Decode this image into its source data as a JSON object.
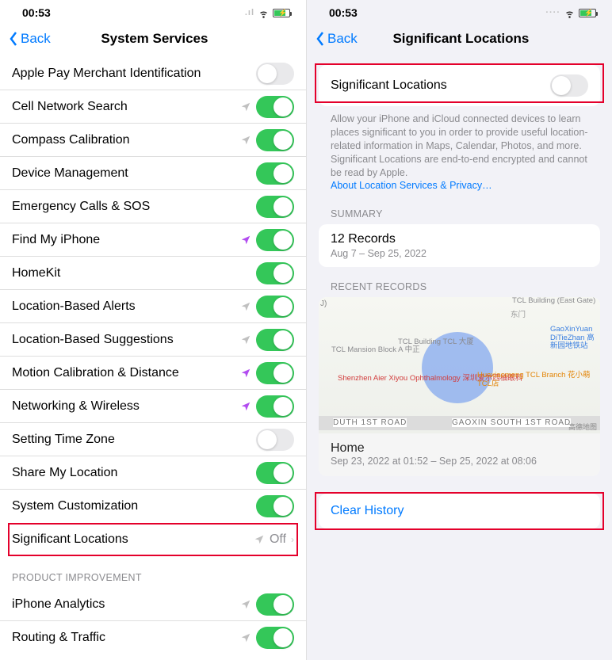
{
  "left": {
    "time": "00:53",
    "back": "Back",
    "title": "System Services",
    "items": [
      {
        "label": "Apple Pay Merchant Identification",
        "toggle": false,
        "loc": null
      },
      {
        "label": "Cell Network Search",
        "toggle": true,
        "loc": "gray"
      },
      {
        "label": "Compass Calibration",
        "toggle": true,
        "loc": "gray"
      },
      {
        "label": "Device Management",
        "toggle": true,
        "loc": null
      },
      {
        "label": "Emergency Calls & SOS",
        "toggle": true,
        "loc": null
      },
      {
        "label": "Find My iPhone",
        "toggle": true,
        "loc": "purple"
      },
      {
        "label": "HomeKit",
        "toggle": true,
        "loc": null
      },
      {
        "label": "Location-Based Alerts",
        "toggle": true,
        "loc": "gray"
      },
      {
        "label": "Location-Based Suggestions",
        "toggle": true,
        "loc": "gray"
      },
      {
        "label": "Motion Calibration & Distance",
        "toggle": true,
        "loc": "purple"
      },
      {
        "label": "Networking & Wireless",
        "toggle": true,
        "loc": "purple"
      },
      {
        "label": "Setting Time Zone",
        "toggle": false,
        "loc": null
      },
      {
        "label": "Share My Location",
        "toggle": true,
        "loc": null
      },
      {
        "label": "System Customization",
        "toggle": true,
        "loc": null
      }
    ],
    "sigloc_label": "Significant Locations",
    "sigloc_value": "Off",
    "section_improvement": "PRODUCT IMPROVEMENT",
    "improvement_items": [
      {
        "label": "iPhone Analytics",
        "toggle": true,
        "loc": "gray"
      },
      {
        "label": "Routing & Traffic",
        "toggle": true,
        "loc": "gray"
      }
    ]
  },
  "right": {
    "time": "00:53",
    "back": "Back",
    "title": "Significant Locations",
    "toggle_label": "Significant Locations",
    "toggle_on": false,
    "desc": "Allow your iPhone and iCloud connected devices to learn places significant to you in order to provide useful location-related information in Maps, Calendar, Photos, and more. Significant Locations are end-to-end encrypted and cannot be read by Apple.",
    "desc_link": "About Location Services & Privacy…",
    "summary_header": "SUMMARY",
    "summary_count": "12 Records",
    "summary_range": "Aug 7 – Sep 25, 2022",
    "recent_header": "RECENT RECORDS",
    "map": {
      "poi_tcl_mansion": "TCL Mansion\nBlock A\n中正",
      "poi_shenzhen": "Shenzhen\nAier Xiyou\nOphthalmology\n深圳爱尔西柚眼科",
      "poi_tcl_building": "TCL Building\nTCL 大厦",
      "poi_huaxiaomeng": "Huaxiaomeng\nTCL Branch\n花小萌 TCL店",
      "poi_dongmen": "东门",
      "poi_east_gate": "TCL Building\n(East Gate)",
      "poi_gaoxin": "GaoXinYuan\nDiTieZhan\n高新园地铁站",
      "poi_j": "J)",
      "road_name": "GAOXIN SOUTH 1ST ROAD",
      "road_name2": "DUTH 1ST ROAD",
      "credit": "高德地图"
    },
    "record_name": "Home",
    "record_range": "Sep 23, 2022 at 01:52 – Sep 25, 2022 at 08:06",
    "clear_history": "Clear History"
  }
}
